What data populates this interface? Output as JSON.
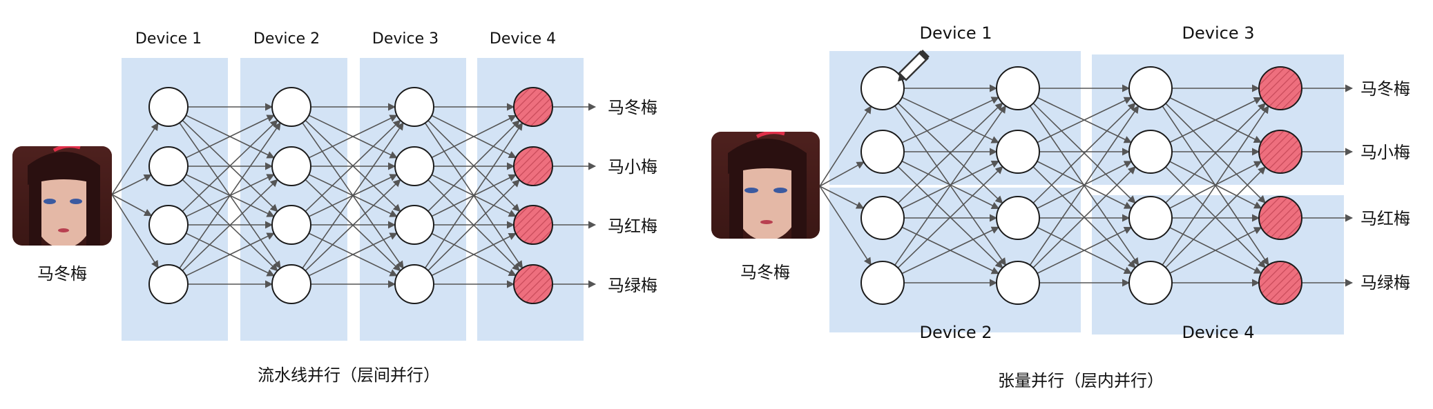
{
  "pipeline": {
    "device_labels": [
      "Device 1",
      "Device 2",
      "Device 3",
      "Device 4"
    ],
    "input_label": "马冬梅",
    "output_labels": [
      "马冬梅",
      "马小梅",
      "马红梅",
      "马绿梅"
    ],
    "caption": "流水线并行（层间并行）"
  },
  "tensor": {
    "device_labels": [
      "Device 1",
      "Device 2",
      "Device 3",
      "Device 4"
    ],
    "input_label": "马冬梅",
    "output_labels": [
      "马冬梅",
      "马小梅",
      "马红梅",
      "马绿梅"
    ],
    "caption": "张量并行（层内并行）"
  },
  "colors": {
    "panel": "#d3e3f5",
    "node_output_fill": "#ee6f7e",
    "node_stroke": "#1a1a1a",
    "edge": "#555555"
  },
  "icons": {
    "photo": "portrait-photo-icon",
    "pencil": "pencil-cursor-icon"
  }
}
